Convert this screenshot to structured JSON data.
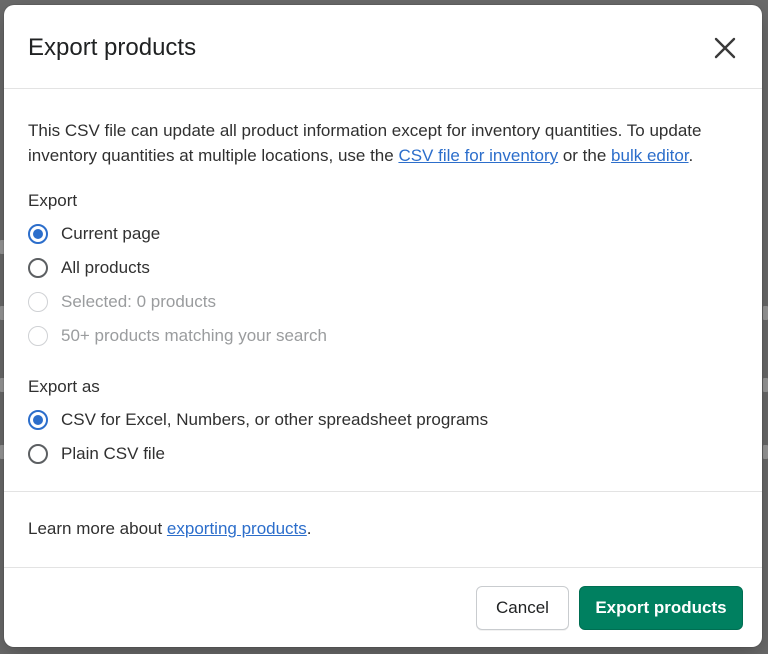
{
  "modal": {
    "title": "Export products",
    "close_icon": "close-icon",
    "intro_text_1": "This CSV file can update all product information except for inventory quantities. To update inventory quantities at multiple locations, use the ",
    "intro_link_1": "CSV file for inventory",
    "intro_text_2": " or the ",
    "intro_link_2": "bulk editor",
    "intro_text_3": ".",
    "export_section": {
      "label": "Export",
      "options": [
        {
          "label": "Current page",
          "checked": true,
          "disabled": false
        },
        {
          "label": "All products",
          "checked": false,
          "disabled": false
        },
        {
          "label": "Selected: 0 products",
          "checked": false,
          "disabled": true
        },
        {
          "label": "50+ products matching your search",
          "checked": false,
          "disabled": true
        }
      ]
    },
    "export_as_section": {
      "label": "Export as",
      "options": [
        {
          "label": "CSV for Excel, Numbers, or other spreadsheet programs",
          "checked": true,
          "disabled": false
        },
        {
          "label": "Plain CSV file",
          "checked": false,
          "disabled": false
        }
      ]
    },
    "learn_more_text": "Learn more about ",
    "learn_more_link": "exporting products",
    "learn_more_suffix": ".",
    "footer": {
      "cancel_label": "Cancel",
      "export_label": "Export products"
    }
  },
  "colors": {
    "accent": "#2c6ecb",
    "primary_button": "#008060",
    "backdrop": "#6b6b6b"
  }
}
